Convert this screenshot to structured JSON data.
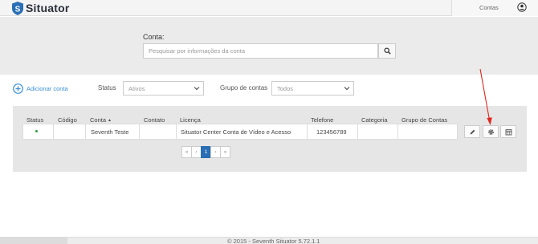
{
  "app": {
    "name": "Situator"
  },
  "navbar": {
    "contas_label": "Contas",
    "user_icon": "user-circle-icon"
  },
  "search": {
    "label": "Conta:",
    "placeholder": "Pesquisar por informações da conta",
    "button_icon": "search-icon"
  },
  "filters": {
    "add_account_label": "Adicionar conta",
    "status_label": "Status",
    "status_value": "Ativos",
    "group_label": "Grupo de contas",
    "group_value": "Todos"
  },
  "table": {
    "headers": {
      "status": "Status",
      "codigo": "Código",
      "conta": "Conta",
      "sort_glyph": "▲",
      "contato": "Contato",
      "licenca": "Licença",
      "telefone": "Telefone",
      "categoria": "Categoria",
      "grupo": "Grupo de Contas"
    },
    "rows": [
      {
        "status": "active",
        "codigo": "",
        "conta": "Seventh Teste",
        "contato": "",
        "licenca": "Situator Center Conta de Vídeo e Acesso",
        "telefone": "123456789",
        "categoria": "",
        "grupo": ""
      }
    ],
    "actions": [
      "edit-icon",
      "gear-icon",
      "calendar-icon"
    ]
  },
  "pagination": {
    "first": "«",
    "prev": "‹",
    "current": "1",
    "next": "›",
    "last": "»"
  },
  "footer": {
    "text": "© 2015 - Seventh Situator 5.72.1.1"
  },
  "colors": {
    "accent": "#3a8fd6",
    "pager_active": "#2a6fb5",
    "status_active": "#2e9e44",
    "annotation": "#e0261f",
    "logo_shield": "#2a6fb5"
  }
}
